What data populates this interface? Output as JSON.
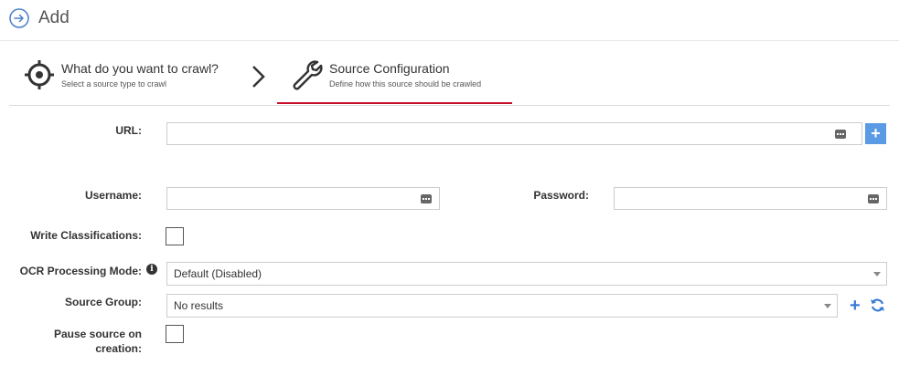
{
  "header": {
    "title": "Add",
    "icon": "arrow-circle-right-icon"
  },
  "steps": [
    {
      "title": "What do you want to crawl?",
      "subtitle": "Select a source type to crawl",
      "icon": "target-icon"
    },
    {
      "title": "Source Configuration",
      "subtitle": "Define how this source should be crawled",
      "icon": "wrench-icon",
      "active": true
    }
  ],
  "form": {
    "url_label": "URL:",
    "username_label": "Username:",
    "password_label": "Password:",
    "write_classifications_label": "Write Classifications:",
    "ocr_label": "OCR Processing Mode:",
    "ocr_value": "Default (Disabled)",
    "source_group_label": "Source Group:",
    "source_group_value": "No results",
    "pause_label_line1": "Pause source on",
    "pause_label_line2": "creation:",
    "add_url_symbol": "+",
    "add_group_symbol": "+",
    "info_symbol": "i"
  },
  "colors": {
    "accent": "#c8102e",
    "button_blue": "#5b9be6",
    "link_blue": "#3a7bd5"
  }
}
